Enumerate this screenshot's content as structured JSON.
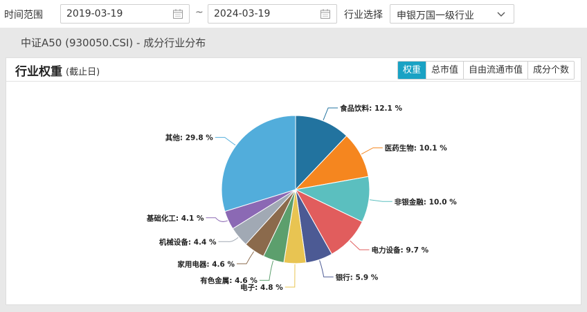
{
  "filters": {
    "time_range_label": "时间范围",
    "start_date": "2019-03-19",
    "separator": "~",
    "end_date": "2024-03-19",
    "industry_label": "行业选择",
    "industry_value": "申银万国一级行业"
  },
  "page_subtitle": "中证A50 (930050.CSI) - 成分行业分布",
  "panel": {
    "title": "行业权重",
    "subtitle": "(截止日)",
    "tabs": [
      "权重",
      "总市值",
      "自由流通市值",
      "成分个数"
    ],
    "active_tab": "权重"
  },
  "chart_data": {
    "type": "pie",
    "unit": "%",
    "slices": [
      {
        "name": "食品饮料",
        "value": 12.1,
        "color": "#22739f"
      },
      {
        "name": "医药生物",
        "value": 10.1,
        "color": "#f5861f"
      },
      {
        "name": "非银金融",
        "value": 10.0,
        "color": "#5bbfbf"
      },
      {
        "name": "电力设备",
        "value": 9.7,
        "color": "#e15d5d"
      },
      {
        "name": "银行",
        "value": 5.9,
        "color": "#4c5a94"
      },
      {
        "name": "电子",
        "value": 4.8,
        "color": "#e8c452"
      },
      {
        "name": "有色金属",
        "value": 4.6,
        "color": "#5c9f6d"
      },
      {
        "name": "家用电器",
        "value": 4.6,
        "color": "#8b6a4c"
      },
      {
        "name": "机械设备",
        "value": 4.4,
        "color": "#a1a9b4"
      },
      {
        "name": "基础化工",
        "value": 4.1,
        "color": "#8b69b4"
      },
      {
        "name": "其他",
        "value": 29.8,
        "color": "#52addb"
      }
    ]
  }
}
